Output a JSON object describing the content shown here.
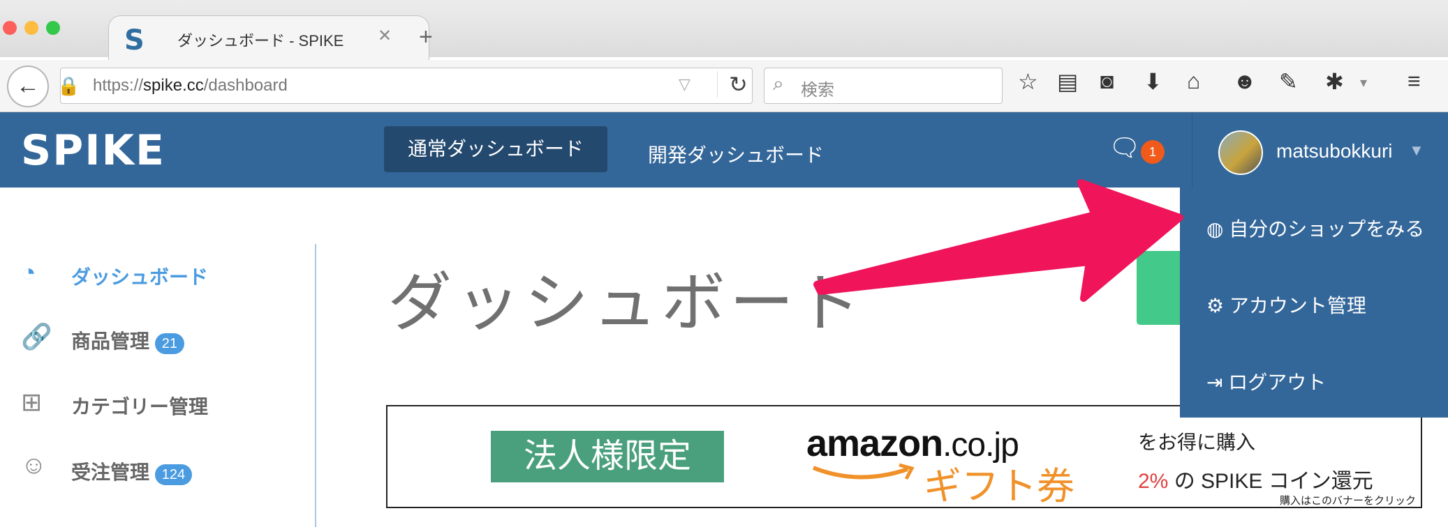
{
  "browser": {
    "tab_title": "ダッシュボード - SPIKE",
    "tab_favicon": "S",
    "tab_close": "✕",
    "new_tab": "+",
    "url_prefix": "https://",
    "url_domain": "spike.cc",
    "url_path": "/dashboard",
    "search_placeholder": "検索",
    "toolbar_icons": [
      "bookmark-star-icon",
      "reading-list-icon",
      "pocket-icon",
      "download-icon",
      "home-icon",
      "chat-icon",
      "addon-icon",
      "bug-icon",
      "menu-icon"
    ]
  },
  "header": {
    "logo": "SPIKE",
    "tabs": [
      {
        "label": "通常ダッシュボード",
        "active": true
      },
      {
        "label": "開発ダッシュボード",
        "active": false
      }
    ],
    "notification_count": "1",
    "username": "matsubokkuri"
  },
  "dropdown": {
    "items": [
      {
        "label": "自分のショップをみる",
        "icon": "globe-icon"
      },
      {
        "label": "アカウント管理",
        "icon": "gear-icon"
      },
      {
        "label": "ログアウト",
        "icon": "logout-icon"
      }
    ]
  },
  "sidebar": {
    "items": [
      {
        "label": "ダッシュボード",
        "icon": "dashboard-icon",
        "active": true
      },
      {
        "label": "商品管理",
        "icon": "link-icon",
        "badge": "21"
      },
      {
        "label": "カテゴリー管理",
        "icon": "sitemap-icon"
      },
      {
        "label": "受注管理",
        "icon": "customer-icon",
        "badge": "124"
      }
    ]
  },
  "main": {
    "title": "ダッシュボード"
  },
  "banner": {
    "corporate_label": "法人様限定",
    "amazon_brand": "amazon",
    "amazon_domain": ".co.jp",
    "gift": "ギフト券",
    "line1": "をお得に購入",
    "line2_pct": "2%",
    "line2_rest": " の SPIKE コイン還元",
    "note": "購入はこのバナーをクリック"
  },
  "colors": {
    "brand": "#336699",
    "accent": "#f0145a",
    "badge": "#4a9be0"
  }
}
